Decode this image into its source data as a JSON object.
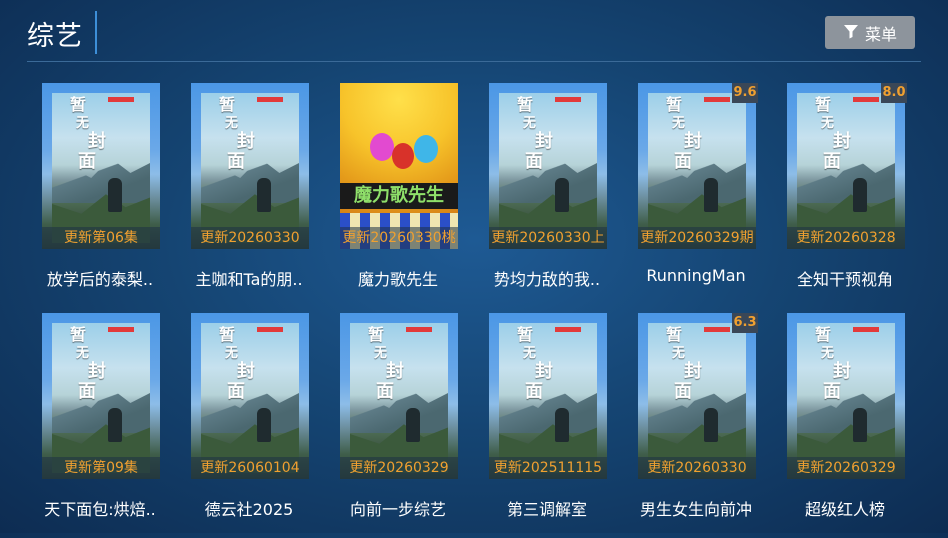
{
  "header": {
    "title": "综艺",
    "menu_label": "菜单"
  },
  "colors": {
    "accent": "#3d8fd8",
    "update_text": "#f0a030",
    "menu_bg": "#8d949c"
  },
  "placeholder_cover": {
    "chars": [
      "暂",
      "无",
      "封",
      "面"
    ]
  },
  "art_cover": {
    "banner": "魔力歌先生"
  },
  "items": [
    {
      "title": "放学后的泰梨..",
      "update": "更新第06集",
      "rating": "",
      "cover": "placeholder"
    },
    {
      "title": "主咖和Ta的朋..",
      "update": "更新20260330",
      "rating": "",
      "cover": "placeholder"
    },
    {
      "title": "魔力歌先生",
      "update": "更新20260330桃",
      "rating": "",
      "cover": "art"
    },
    {
      "title": "势均力敌的我..",
      "update": "更新20260330上",
      "rating": "",
      "cover": "placeholder"
    },
    {
      "title": "RunningMan",
      "update": "更新20260329期",
      "rating": "9.6",
      "cover": "placeholder"
    },
    {
      "title": "全知干预视角",
      "update": "更新20260328",
      "rating": "8.0",
      "cover": "placeholder"
    },
    {
      "title": "天下面包:烘焙..",
      "update": "更新第09集",
      "rating": "",
      "cover": "placeholder"
    },
    {
      "title": "德云社2025",
      "update": "更新26060104",
      "rating": "",
      "cover": "placeholder"
    },
    {
      "title": "向前一步综艺",
      "update": "更新20260329",
      "rating": "",
      "cover": "placeholder"
    },
    {
      "title": "第三调解室",
      "update": "更新202511115",
      "rating": "",
      "cover": "placeholder"
    },
    {
      "title": "男生女生向前冲",
      "update": "更新20260330",
      "rating": "6.3",
      "cover": "placeholder"
    },
    {
      "title": "超级红人榜",
      "update": "更新20260329",
      "rating": "",
      "cover": "placeholder"
    }
  ]
}
